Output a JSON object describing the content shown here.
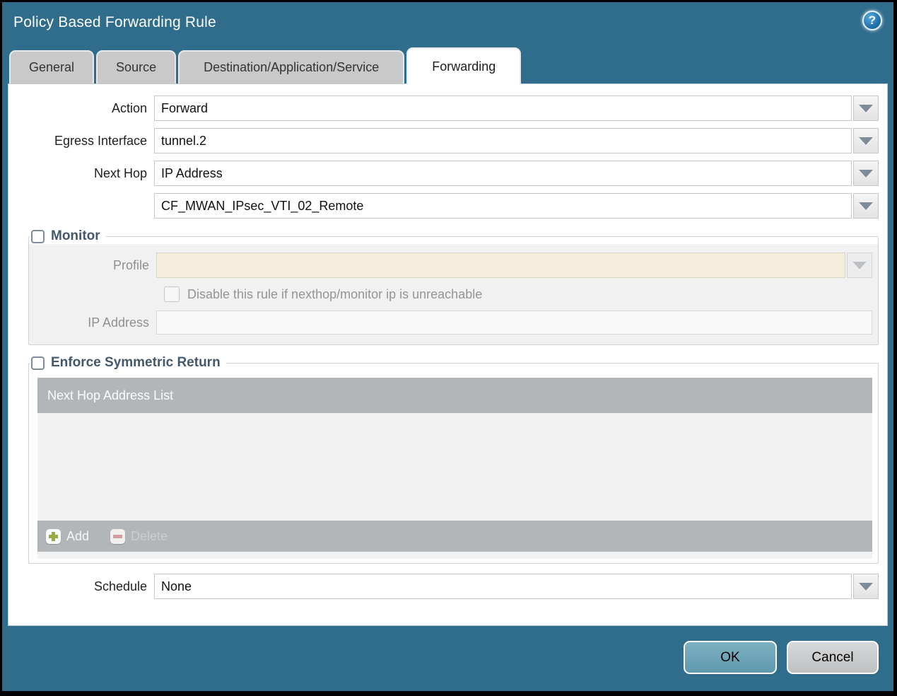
{
  "colors": {
    "titlebar_teal": "#306d8d",
    "tab_inactive": "#c9c9c9",
    "tab_active": "#ffffff",
    "ok_button": "#6ba4b6",
    "cancel_button": "#c8cacb",
    "table_header_gray": "#b2b6b9",
    "disabled_field_beige": "#f5eedd",
    "section_title": "#44586c",
    "add_plus_green": "#93ad3e",
    "delete_minus_red": "#cf9d9d"
  },
  "window": {
    "title": "Policy Based Forwarding Rule",
    "help_icon": "?"
  },
  "tabs": [
    {
      "label": "General",
      "active": false
    },
    {
      "label": "Source",
      "active": false
    },
    {
      "label": "Destination/Application/Service",
      "active": false
    },
    {
      "label": "Forwarding",
      "active": true
    }
  ],
  "form": {
    "action": {
      "label": "Action",
      "value": "Forward"
    },
    "egress_interface": {
      "label": "Egress Interface",
      "value": "tunnel.2"
    },
    "next_hop": {
      "label": "Next Hop",
      "value": "IP Address"
    },
    "next_hop_address": {
      "value": "CF_MWAN_IPsec_VTI_02_Remote"
    },
    "monitor": {
      "label": "Monitor",
      "checked": false,
      "profile": {
        "label": "Profile",
        "value": ""
      },
      "disable_rule": {
        "label": "Disable this rule if nexthop/monitor ip is unreachable",
        "checked": false
      },
      "ip_address": {
        "label": "IP Address",
        "value": ""
      }
    },
    "enforce_symmetric_return": {
      "label": "Enforce Symmetric Return",
      "checked": false,
      "table": {
        "header": "Next Hop Address List",
        "rows": []
      },
      "add_button": "Add",
      "delete_button": "Delete"
    },
    "schedule": {
      "label": "Schedule",
      "value": "None"
    }
  },
  "actions": {
    "ok": "OK",
    "cancel": "Cancel"
  }
}
